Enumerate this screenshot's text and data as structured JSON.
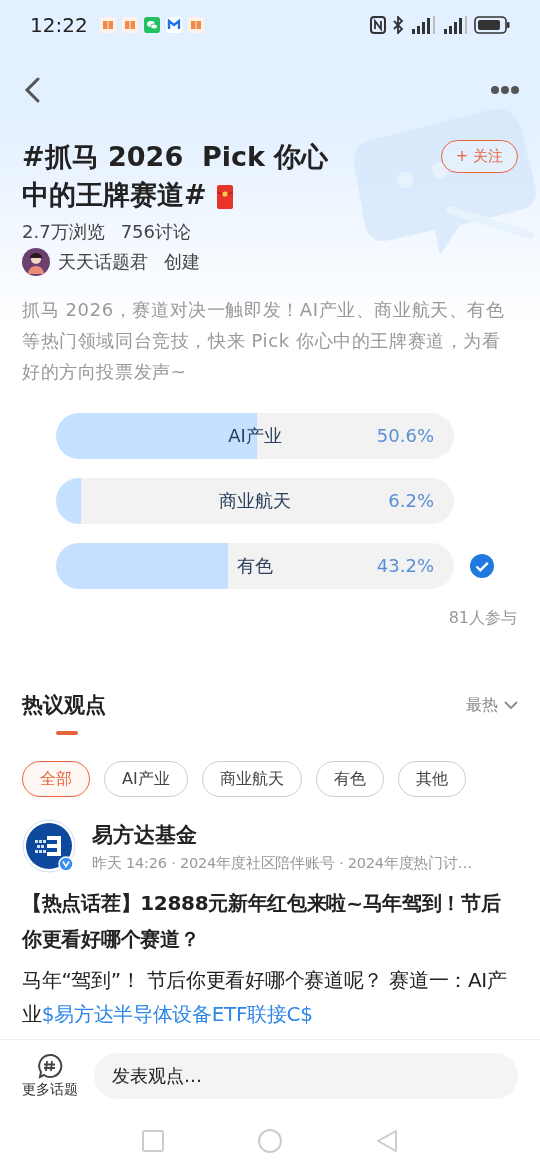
{
  "status_bar": {
    "time": "12:22"
  },
  "topic": {
    "title": "#抓马 2026  Pick 你心中的王牌赛道#",
    "follow_button": "+ 关注",
    "views": "2.7万浏览",
    "discussions": "756讨论",
    "creator": "天天话题君",
    "creator_action": "创建",
    "description": "抓马 2026，赛道对决一触即发！AI产业、商业航天、有色等热门领域同台竞技，快来 Pick 你心中的王牌赛道，为看好的方向投票发声~"
  },
  "poll": {
    "options": [
      {
        "label": "AI产业",
        "percent": "50.6%",
        "level": 0.506,
        "selected": false
      },
      {
        "label": "商业航天",
        "percent": "6.2%",
        "level": 0.062,
        "selected": false
      },
      {
        "label": "有色",
        "percent": "43.2%",
        "level": 0.432,
        "selected": true
      }
    ],
    "participants": "81人参与"
  },
  "discussion": {
    "heading": "热议观点",
    "sort": "最热",
    "filters": [
      {
        "label": "全部",
        "selected": true
      },
      {
        "label": "AI产业",
        "selected": false
      },
      {
        "label": "商业航天",
        "selected": false
      },
      {
        "label": "有色",
        "selected": false
      },
      {
        "label": "其他",
        "selected": false
      }
    ],
    "post": {
      "author": "易方达基金",
      "meta": "昨天 14:26 · 2024年度社区陪伴账号 · 2024年度热门讨…",
      "title": "【热点话茬】12888元新年红包来啦~马年驾到！节后你更看好哪个赛道？",
      "body": "马年“驾到”！ 节后你更看好哪个赛道呢？ 赛道一：AI产业",
      "link": "$易方达半导体设备ETF联接C$"
    }
  },
  "bottom_bar": {
    "more_topics": "更多话题",
    "comment_placeholder": "发表观点…"
  }
}
